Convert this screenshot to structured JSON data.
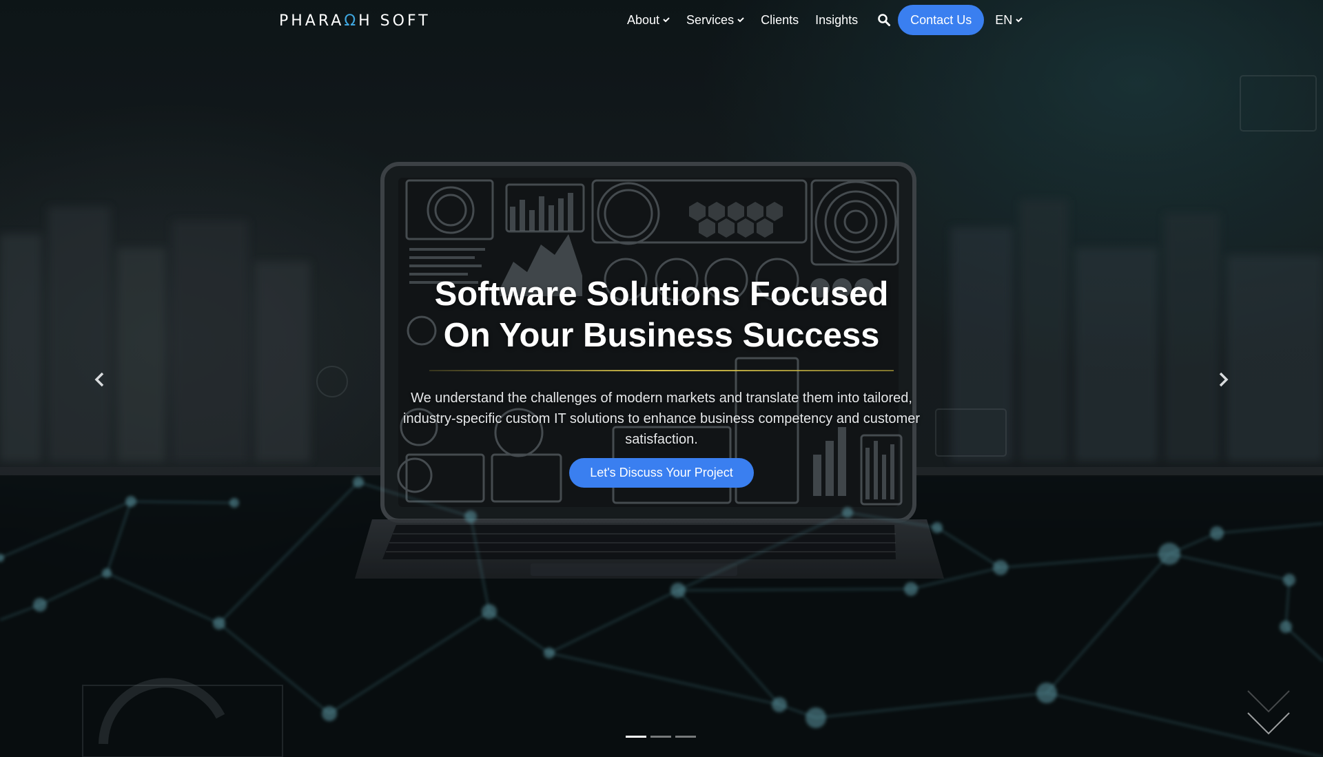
{
  "brand": {
    "logo_part1": "PHARA",
    "logo_accent": "Ω",
    "logo_part2": "H SOFT"
  },
  "nav": {
    "about": "About",
    "services": "Services",
    "clients": "Clients",
    "insights": "Insights",
    "contact": "Contact Us",
    "language": "EN"
  },
  "hero": {
    "title_line1": "Software Solutions Focused",
    "title_line2": "On Your Business Success",
    "subtitle": "We understand the challenges of modern markets and translate them into tailored, industry-specific custom IT solutions to enhance business competency and customer satisfaction.",
    "cta": "Let's Discuss Your Project"
  },
  "carousel": {
    "slide_count": 3,
    "active_slide": 1
  },
  "colors": {
    "accent": "#3a7ff0",
    "divider": "#d7c24a",
    "logo_accent": "#3fa7e0"
  },
  "icons": {
    "search": "search-icon",
    "prev": "chevron-left-icon",
    "next": "chevron-right-icon",
    "dropdown": "chevron-down-icon",
    "scroll": "chevron-down-large-icon"
  }
}
